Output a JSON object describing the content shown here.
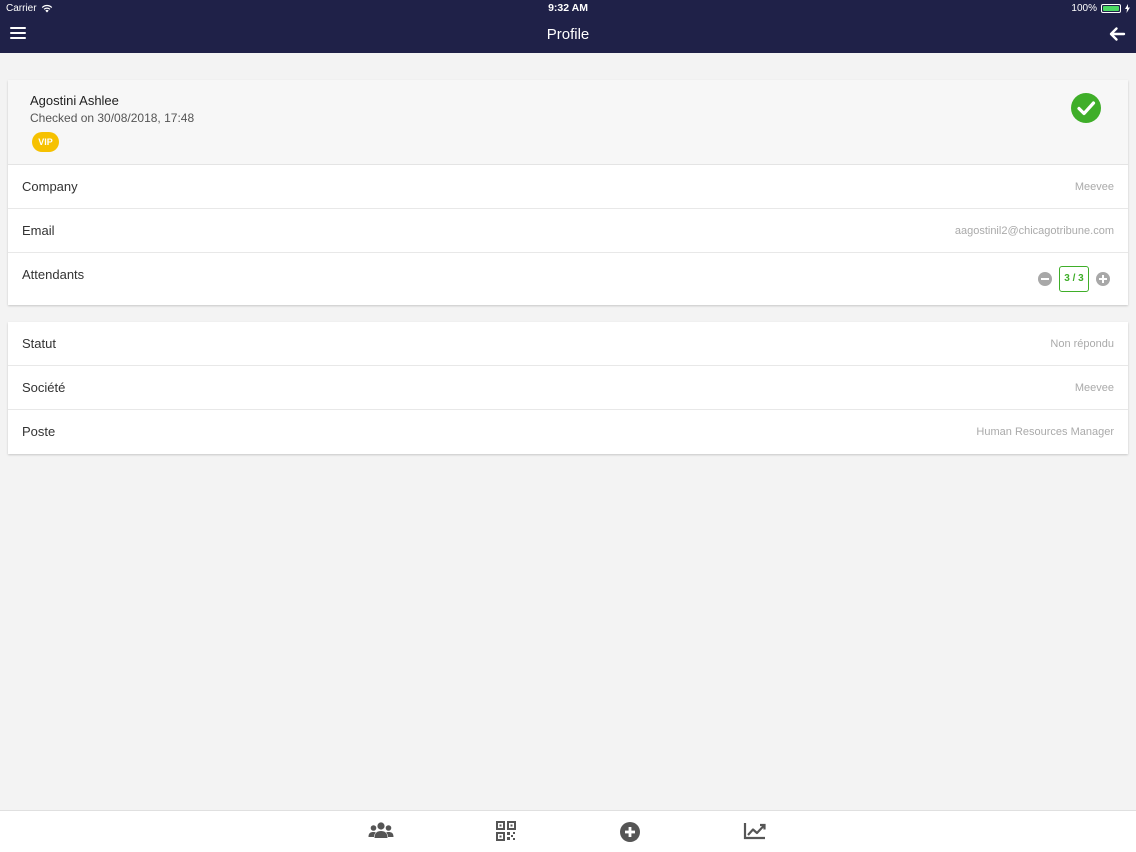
{
  "status_bar": {
    "carrier": "Carrier",
    "time": "9:32 AM",
    "battery": "100%"
  },
  "navbar": {
    "title": "Profile",
    "menu_icon": "hamburger-menu-icon",
    "back_icon": "arrow-left-icon"
  },
  "profile": {
    "name": "Agostini Ashlee",
    "checked": "Checked on 30/08/2018, 17:48",
    "badge": "VIP",
    "status_icon": "check-circle-icon"
  },
  "details": [
    {
      "label": "Company",
      "value": "Meevee"
    },
    {
      "label": "Email",
      "value": "aagostinil2@chicagotribune.com"
    }
  ],
  "attendants": {
    "label": "Attendants",
    "count": "3 / 3"
  },
  "fields": [
    {
      "label": "Statut",
      "value": "Non répondu"
    },
    {
      "label": "Société",
      "value": "Meevee"
    },
    {
      "label": "Poste",
      "value": "Human Resources Manager"
    }
  ],
  "tabbar": {
    "items": [
      "users-icon",
      "qr-code-icon",
      "plus-circle-icon",
      "chart-line-icon"
    ]
  },
  "colors": {
    "navbar": "#1f2148",
    "accent_green": "#3fae29",
    "vip": "#f6c100"
  }
}
